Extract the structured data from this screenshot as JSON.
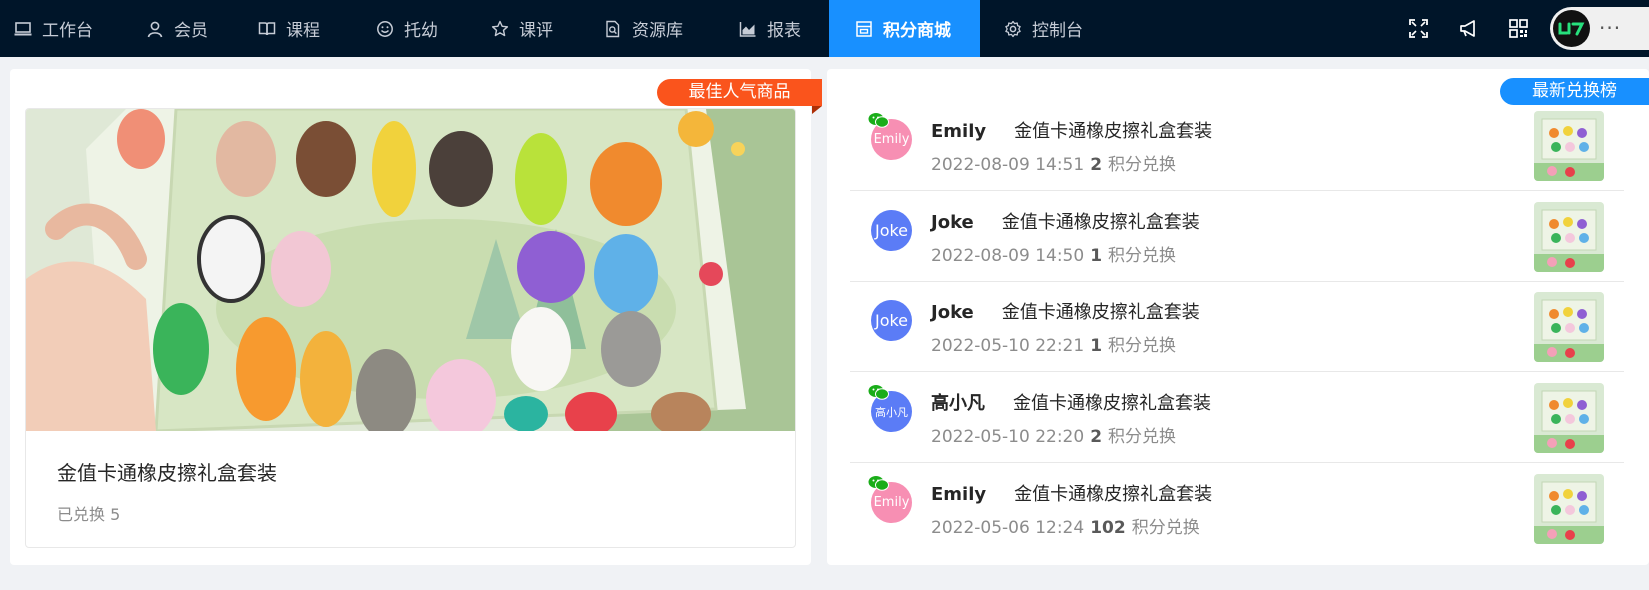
{
  "nav": {
    "items": [
      {
        "label": "工作台",
        "icon": "laptop-icon"
      },
      {
        "label": "会员",
        "icon": "user-icon"
      },
      {
        "label": "课程",
        "icon": "book-icon"
      },
      {
        "label": "托幼",
        "icon": "smile-icon"
      },
      {
        "label": "课评",
        "icon": "star-icon"
      },
      {
        "label": "资源库",
        "icon": "file-search-icon"
      },
      {
        "label": "报表",
        "icon": "area-chart-icon"
      },
      {
        "label": "积分商城",
        "icon": "shop-icon"
      },
      {
        "label": "控制台",
        "icon": "gear-icon"
      }
    ],
    "active": "积分商城"
  },
  "header_actions": [
    "fullscreen-icon",
    "notification-icon",
    "qrcode-icon"
  ],
  "user_menu": {
    "dots": "···"
  },
  "featured": {
    "ribbon": "最佳人气商品",
    "product_name": "金值卡通橡皮擦礼盒套装",
    "exchanged_label": "已兑换 5",
    "exchanged": 5
  },
  "ranking": {
    "ribbon": "最新兑换榜",
    "suffix": "积分兑换",
    "rows": [
      {
        "name": "Emily",
        "avatar_text": "Emily",
        "avatar_color": "#f78fb3",
        "wechat": true,
        "product": "金值卡通橡皮擦礼盒套装",
        "time": "2022-08-09 14:51",
        "points": "2"
      },
      {
        "name": "Joke",
        "avatar_text": "Joke",
        "avatar_color": "#5b7cf6",
        "wechat": false,
        "product": "金值卡通橡皮擦礼盒套装",
        "time": "2022-08-09 14:50",
        "points": "1"
      },
      {
        "name": "Joke",
        "avatar_text": "Joke",
        "avatar_color": "#5b7cf6",
        "wechat": false,
        "product": "金值卡通橡皮擦礼盒套装",
        "time": "2022-05-10 22:21",
        "points": "1"
      },
      {
        "name": "高小凡",
        "avatar_text": "高小凡",
        "avatar_color": "#5b7cf6",
        "wechat": true,
        "product": "金值卡通橡皮擦礼盒套装",
        "time": "2022-05-10 22:20",
        "points": "2"
      },
      {
        "name": "Emily",
        "avatar_text": "Emily",
        "avatar_color": "#f78fb3",
        "wechat": true,
        "product": "金值卡通橡皮擦礼盒套装",
        "time": "2022-05-06 12:24",
        "points": "102"
      }
    ]
  },
  "colors": {
    "topbar": "#001529",
    "active_nav": "#1890ff",
    "ribbon_orange": "#fa541c",
    "ribbon_blue": "#1890ff"
  }
}
